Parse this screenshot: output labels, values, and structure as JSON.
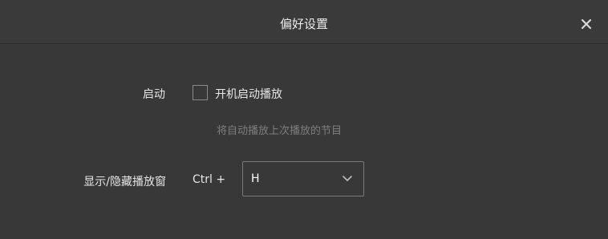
{
  "dialog": {
    "title": "偏好设置",
    "close_icon": "close-icon"
  },
  "startup": {
    "label": "启动",
    "checkbox_label": "开机启动播放",
    "checked": false,
    "hint": "将自动播放上次播放的节目"
  },
  "hotkey": {
    "label": "显示/隐藏播放窗",
    "prefix": "Ctrl +",
    "selected_key": "H",
    "chevron_icon": "chevron-down-icon"
  },
  "colors": {
    "background": "#383838",
    "text": "#e6e6e6",
    "hint_text": "#7e7e7e",
    "border": "#7a7a7a"
  }
}
